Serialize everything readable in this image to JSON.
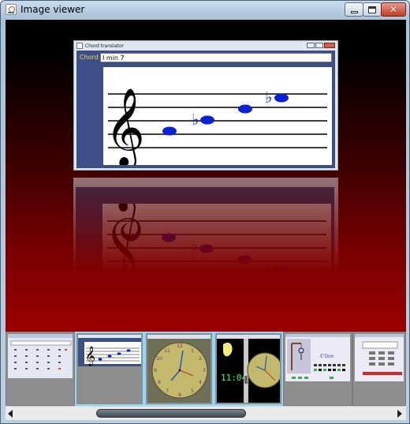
{
  "window": {
    "title": "Image viewer",
    "icon": "java-cup-icon",
    "controls": [
      "minimize",
      "maximize",
      "close"
    ]
  },
  "featured": {
    "window_title": "Chord translator",
    "chord_label": "Chord",
    "chord_value": "I min 7",
    "notes": [
      {
        "name": "C",
        "accidental": ""
      },
      {
        "name": "Eb",
        "accidental": "♭"
      },
      {
        "name": "G",
        "accidental": ""
      },
      {
        "name": "Bb",
        "accidental": "♭"
      }
    ]
  },
  "thumbnails": [
    {
      "name": "calculator",
      "selected": false
    },
    {
      "name": "chord-translator",
      "selected": true
    },
    {
      "name": "analog-clock",
      "selected": true,
      "dial_color": "#c3b96a"
    },
    {
      "name": "clock-with-digital",
      "selected": true,
      "digital_time": "11:04"
    },
    {
      "name": "hangman-game",
      "selected": false,
      "text": "E'Doo"
    },
    {
      "name": "pin-pad",
      "selected": false
    }
  ],
  "colors": {
    "stage_red": "#9a0000",
    "note_blue": "#0a1fd8",
    "selection_border": "#8fd7ff",
    "digital_green": "#33ff66"
  }
}
